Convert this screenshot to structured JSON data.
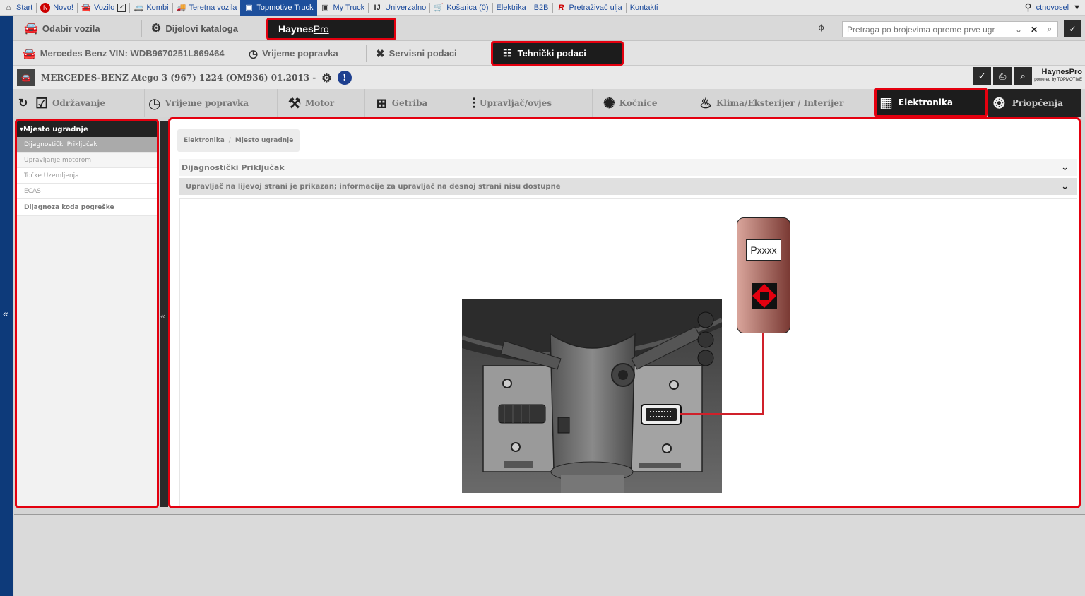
{
  "topnav": {
    "items": [
      {
        "label": "Start",
        "icon": "home-icon"
      },
      {
        "label": "Novo!",
        "icon": "new-badge-icon"
      },
      {
        "label": "Vozilo",
        "icon": "car-icon"
      },
      {
        "label": "Kombi",
        "icon": "van-icon"
      },
      {
        "label": "Teretna vozila",
        "icon": "truck-icon"
      },
      {
        "label": "Topmotive Truck",
        "icon": "topmotive-truck-icon"
      },
      {
        "label": "My Truck",
        "icon": "mytruck-icon"
      },
      {
        "label": "Univerzalno",
        "icon": "universal-icon"
      },
      {
        "label": "Košarica (0)",
        "icon": "cart-icon"
      },
      {
        "label": "Elektrika",
        "icon": ""
      },
      {
        "label": "B2B",
        "icon": ""
      },
      {
        "label": "Pretraživač ulja",
        "icon": "oil-search-icon"
      },
      {
        "label": "Kontakti",
        "icon": ""
      }
    ],
    "user": "ctnovosel"
  },
  "row2": {
    "odabir": "Odabir vozila",
    "dijelovi": "Dijelovi kataloga",
    "haynes_brand": "Haynes",
    "haynes_pro": "Pro",
    "search_placeholder": "Pretraga po brojevima opreme prve ugr"
  },
  "row3": {
    "vin": "Mercedes Benz VIN: WDB9670251L869464",
    "vrijeme": "Vrijeme popravka",
    "servisni": "Servisni podaci",
    "tehnicki": "Tehnički podaci"
  },
  "vehicle": {
    "name": "MERCEDES-BENZ Atego 3 (967) 1224 (OM936) 01.2013 -",
    "haynes_logo": "HaynesPro",
    "haynes_powered": "powered by TOPMOTIVE"
  },
  "categories": [
    {
      "label": "Održavanje",
      "icon": "checklist-icon"
    },
    {
      "label": "Vrijeme popravka",
      "icon": "clock-icon"
    },
    {
      "label": "Motor",
      "icon": "piston-icon"
    },
    {
      "label": "Getriba",
      "icon": "gearbox-icon"
    },
    {
      "label": "Upravljač/ovjes",
      "icon": "suspension-icon"
    },
    {
      "label": "Kočnice",
      "icon": "brake-icon"
    },
    {
      "label": "Klima/Eksterijer / Interijer",
      "icon": "seat-icon"
    },
    {
      "label": "Elektronika",
      "icon": "chip-icon"
    },
    {
      "label": "Priopćenja",
      "icon": "bulb-icon"
    }
  ],
  "sidebar": {
    "header": "Mjesto ugradnje",
    "items": [
      "Dijagnostički Priključak",
      "Upravljanje motorom",
      "Točke Uzemljenja",
      "ECAS",
      "Dijagnoza koda pogreške"
    ]
  },
  "main": {
    "breadcrumb": [
      "Elektronika",
      "Mjesto ugradnje"
    ],
    "breadcrumb_sep": "/",
    "accordion1": "Dijagnostički Priključak",
    "accordion2": "Upravljač na lijevoj strani je prikazan; informacije za upravljač na desnoj strani nisu dostupne",
    "connector_label": "Pxxxx"
  },
  "colors": {
    "highlight": "#e4000f",
    "nav_blue": "#1d4f9c",
    "dark_tab": "#1c1c1c"
  }
}
